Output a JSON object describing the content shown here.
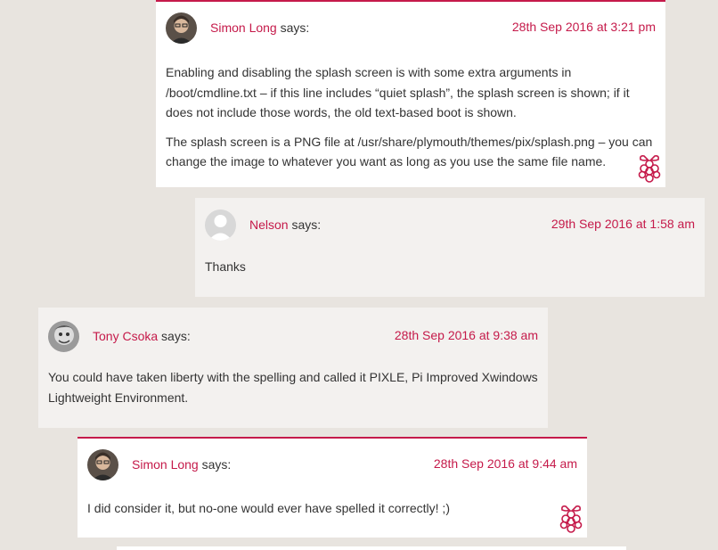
{
  "comments": [
    {
      "author": "Simon Long",
      "says": "says:",
      "date": "28th Sep 2016 at 3:21 pm",
      "paragraphs": [
        "Enabling and disabling the splash screen is with some extra arguments in /boot/cmdline.txt – if this line includes “quiet splash”, the splash screen is shown; if it does not include those words, the old text-based boot is shown.",
        "The splash screen is a PNG file at /usr/share/plymouth/themes/pix/splash.png – you can change the image to whatever you want as long as you use the same file name."
      ],
      "badge": "raspberry-pi-icon"
    },
    {
      "author": "Nelson",
      "says": "says:",
      "date": "29th Sep 2016 at 1:58 am",
      "paragraphs": [
        "Thanks"
      ]
    },
    {
      "author": "Tony Csoka",
      "says": "says:",
      "date": "28th Sep 2016 at 9:38 am",
      "paragraphs": [
        "You could have taken liberty with the spelling and called it PIXLE, Pi Improved Xwindows Lightweight Environment."
      ]
    },
    {
      "author": "Simon Long",
      "says": "says:",
      "date": "28th Sep 2016 at 9:44 am",
      "paragraphs": [
        "I did consider it, but no-one would ever have spelled it correctly! ;)"
      ],
      "badge": "raspberry-pi-icon"
    }
  ],
  "colors": {
    "accent": "#c51a4a",
    "page_bg": "#e8e4df",
    "author_card_bg": "#ffffff",
    "guest_card_bg": "#f3f1ef",
    "text": "#333333"
  }
}
